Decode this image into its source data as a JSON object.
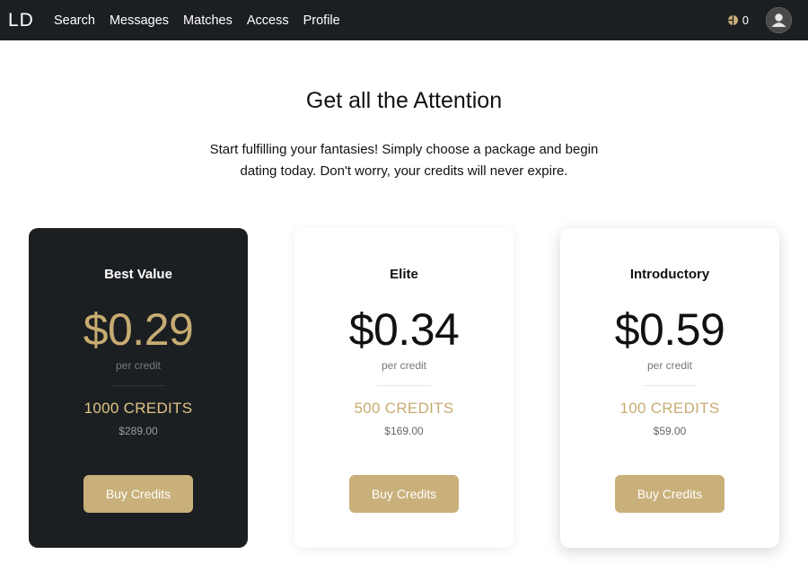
{
  "nav": {
    "logo": "LD",
    "links": [
      {
        "label": "Search"
      },
      {
        "label": "Messages"
      },
      {
        "label": "Matches"
      },
      {
        "label": "Access"
      },
      {
        "label": "Profile"
      }
    ],
    "credit_count": "0",
    "coin_icon": "coin-icon",
    "avatar_icon": "user-icon"
  },
  "hero": {
    "title": "Get all the Attention",
    "line1": "Start fulfilling your fantasies! Simply choose a package and begin",
    "line2": "dating today. Don't worry, your credits will never expire."
  },
  "plans": [
    {
      "name": "Best Value",
      "price": "$0.29",
      "per": "per credit",
      "credits": "1000 CREDITS",
      "total": "$289.00",
      "button": "Buy Credits"
    },
    {
      "name": "Elite",
      "price": "$0.34",
      "per": "per credit",
      "credits": "500 CREDITS",
      "total": "$169.00",
      "button": "Buy Credits"
    },
    {
      "name": "Introductory",
      "price": "$0.59",
      "per": "per credit",
      "credits": "100 CREDITS",
      "total": "$59.00",
      "button": "Buy Credits"
    }
  ],
  "colors": {
    "navbar": "#1c1f22",
    "accent_gold": "#c9b07a",
    "dark_card": "#1c1f22"
  }
}
